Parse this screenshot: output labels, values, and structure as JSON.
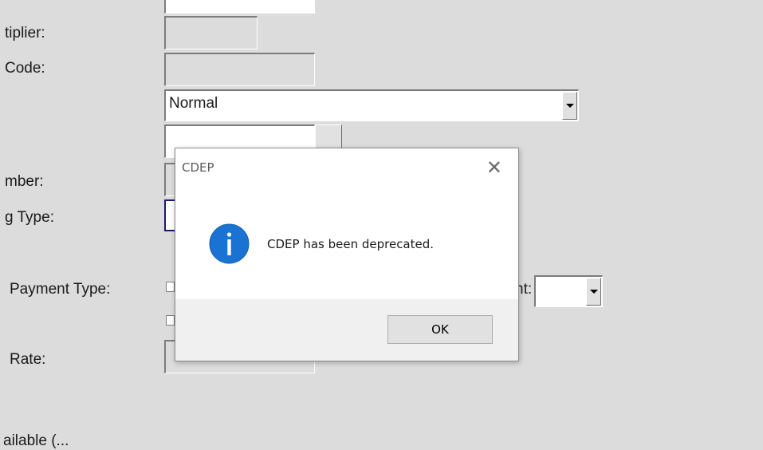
{
  "form": {
    "labels": {
      "multiplier": "tiplier:",
      "code": "Code:",
      "number": "mber:",
      "type": "g Type:",
      "payment_type": "Payment Type:",
      "rate": "Rate:",
      "right_partial": "nt:",
      "bottom_partial": "ailable (..."
    },
    "status_select": {
      "value": "Normal"
    }
  },
  "dialog": {
    "title": "CDEP",
    "close_glyph": "✕",
    "icon": "info-icon",
    "icon_color": "#1a73d2",
    "message": "CDEP has been deprecated.",
    "ok_label": "OK"
  }
}
